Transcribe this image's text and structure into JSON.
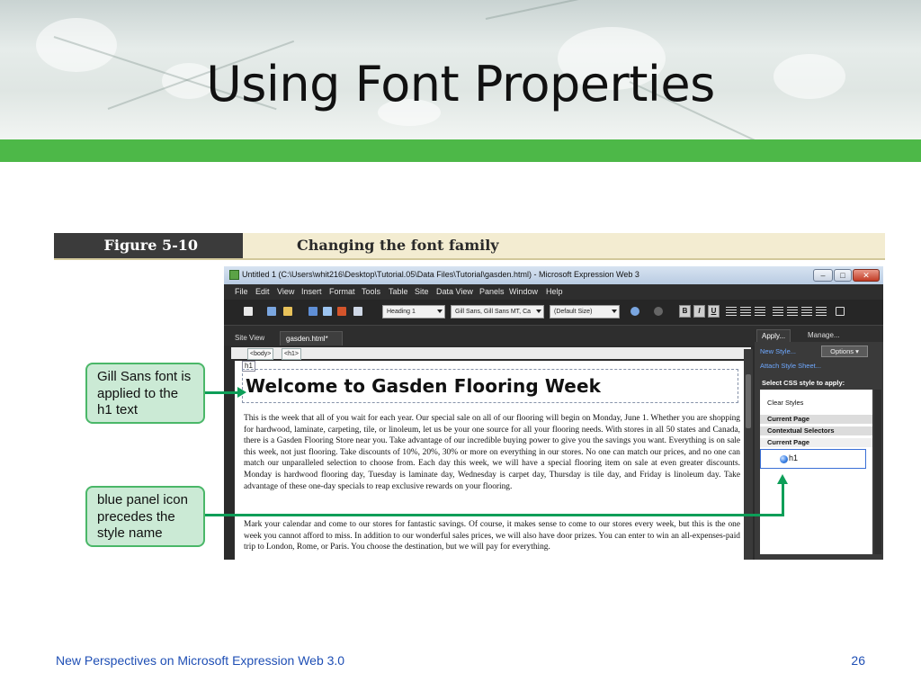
{
  "slide": {
    "title": "Using Font Properties",
    "footer_text": "New Perspectives on Microsoft Expression Web 3.0",
    "page_number": "26",
    "accent_color": "#4db848"
  },
  "figure": {
    "number": "Figure 5-10",
    "caption": "Changing the font family"
  },
  "app": {
    "window_title": "Untitled 1 (C:\\Users\\whit216\\Desktop\\Tutorial.05\\Data Files\\Tutorial\\gasden.html) - Microsoft Expression Web 3",
    "menu": [
      "File",
      "Edit",
      "View",
      "Insert",
      "Format",
      "Tools",
      "Table",
      "Site",
      "Data View",
      "Panels",
      "Window",
      "Help"
    ],
    "toolbar": {
      "style_dropdown": "Heading 1",
      "font_dropdown": "Gill Sans, Gill Sans MT, Ca",
      "size_dropdown": "(Default Size)",
      "bold": "B",
      "italic": "I",
      "underline": "U"
    },
    "tabs": [
      "Site View",
      "gasden.html*"
    ],
    "breadcrumbs": [
      "<body>",
      "<h1>"
    ],
    "tag_label": "h1",
    "heading": "Welcome to Gasden Flooring Week",
    "paragraphs": [
      "This is the week that all of you wait for each year. Our special sale on all of our flooring will begin on Monday, June 1. Whether you are shopping for hardwood, laminate, carpeting, tile, or linoleum, let us be your one source for all your flooring needs. With stores in all 50 states and Canada, there is a Gasden Flooring Store near you. Take advantage of our incredible buying power to give you the savings you want. Everything is on sale this week, not just flooring. Take discounts of 10%, 20%, 30% or more on everything in our stores. No one can match our prices, and no one can match our unparalleled selection to choose from. Each day this week, we will have a special flooring item on sale at even greater discounts. Monday is hardwood flooring day, Tuesday is laminate day, Wednesday is carpet day, Thursday is tile day, and Friday is linoleum day. Take advantage of these one-day specials to reap exclusive rewards on your flooring.",
      "Mark your calendar and come to our stores for fantastic savings. Of course, it makes sense to come to our stores every week, but this is the one week you cannot afford to miss. In addition to our wonderful sales prices, we will also have door prizes. You can enter to win an all-expenses-paid trip to London, Rome, or Paris. You choose the destination, but we will pay for everything."
    ],
    "panel": {
      "tabs": [
        "Apply...",
        "Manage..."
      ],
      "new_style": "New Style...",
      "options": "Options",
      "attach": "Attach Style Sheet...",
      "select_label": "Select CSS style to apply:",
      "clear_styles": "Clear Styles",
      "current_page_1": "Current Page",
      "contextual": "Contextual Selectors",
      "current_page_2": "Current Page",
      "style_name": "h1"
    }
  },
  "callouts": {
    "first": [
      "Gill Sans font is",
      "applied to the",
      "h1 text"
    ],
    "second": [
      "blue panel icon",
      "precedes the",
      "style name"
    ]
  }
}
